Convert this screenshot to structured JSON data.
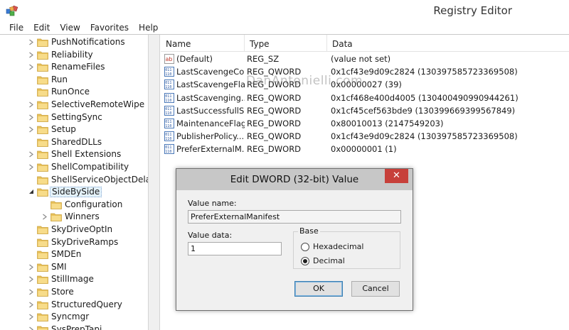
{
  "window": {
    "title": "Registry Editor"
  },
  "menu": [
    "File",
    "Edit",
    "View",
    "Favorites",
    "Help"
  ],
  "tree": {
    "items": [
      {
        "label": "PushNotifications",
        "level": 0,
        "expandable": true
      },
      {
        "label": "Reliability",
        "level": 0,
        "expandable": true
      },
      {
        "label": "RenameFiles",
        "level": 0,
        "expandable": true
      },
      {
        "label": "Run",
        "level": 0,
        "expandable": false
      },
      {
        "label": "RunOnce",
        "level": 0,
        "expandable": false
      },
      {
        "label": "SelectiveRemoteWipe",
        "level": 0,
        "expandable": true
      },
      {
        "label": "SettingSync",
        "level": 0,
        "expandable": true
      },
      {
        "label": "Setup",
        "level": 0,
        "expandable": true
      },
      {
        "label": "SharedDLLs",
        "level": 0,
        "expandable": false
      },
      {
        "label": "Shell Extensions",
        "level": 0,
        "expandable": true
      },
      {
        "label": "ShellCompatibility",
        "level": 0,
        "expandable": true
      },
      {
        "label": "ShellServiceObjectDelayLo",
        "level": 0,
        "expandable": false
      },
      {
        "label": "SideBySide",
        "level": 0,
        "expandable": true,
        "expanded": true,
        "selected": true
      },
      {
        "label": "Configuration",
        "level": 1,
        "expandable": false
      },
      {
        "label": "Winners",
        "level": 1,
        "expandable": true
      },
      {
        "label": "SkyDriveOptIn",
        "level": 0,
        "expandable": false
      },
      {
        "label": "SkyDriveRamps",
        "level": 0,
        "expandable": false
      },
      {
        "label": "SMDEn",
        "level": 0,
        "expandable": false
      },
      {
        "label": "SMI",
        "level": 0,
        "expandable": true
      },
      {
        "label": "StillImage",
        "level": 0,
        "expandable": true
      },
      {
        "label": "Store",
        "level": 0,
        "expandable": true
      },
      {
        "label": "StructuredQuery",
        "level": 0,
        "expandable": true
      },
      {
        "label": "Syncmgr",
        "level": 0,
        "expandable": true
      },
      {
        "label": "SysPrepTapi",
        "level": 0,
        "expandable": true
      }
    ]
  },
  "list": {
    "columns": {
      "name": "Name",
      "type": "Type",
      "data": "Data"
    },
    "rows": [
      {
        "icon": "string-value-icon",
        "name": "(Default)",
        "type": "REG_SZ",
        "data": "(value not set)"
      },
      {
        "icon": "binary-value-icon",
        "name": "LastScavengeCo...",
        "type": "REG_QWORD",
        "data": "0x1cf43e9d09c2824 (130397585723369508)"
      },
      {
        "icon": "binary-value-icon",
        "name": "LastScavengeFla...",
        "type": "REG_DWORD",
        "data": "0x00000027 (39)"
      },
      {
        "icon": "binary-value-icon",
        "name": "LastScavenging...",
        "type": "REG_QWORD",
        "data": "0x1cf468e400d4005 (130400490990944261)"
      },
      {
        "icon": "binary-value-icon",
        "name": "LastSuccessfullS...",
        "type": "REG_QWORD",
        "data": "0x1cf45cef563bde9 (130399669399567849)"
      },
      {
        "icon": "binary-value-icon",
        "name": "MaintenanceFlags",
        "type": "REG_DWORD",
        "data": "0x80010013 (2147549203)"
      },
      {
        "icon": "binary-value-icon",
        "name": "PublisherPolicy...",
        "type": "REG_QWORD",
        "data": "0x1cf43e9d09c2824 (130397585723369508)"
      },
      {
        "icon": "binary-value-icon",
        "name": "PreferExternalM...",
        "type": "REG_DWORD",
        "data": "0x00000001 (1)"
      }
    ]
  },
  "dialog": {
    "title": "Edit DWORD (32-bit) Value",
    "close_label": "✕",
    "value_name_label": "Value name:",
    "value_name": "PreferExternalManifest",
    "value_data_label": "Value data:",
    "value_data": "1",
    "base_label": "Base",
    "hex_label": "Hexadecimal",
    "dec_label": "Decimal",
    "selected_base": "Decimal",
    "ok_label": "OK",
    "cancel_label": "Cancel"
  },
  "watermark": "DanAntonielli.com",
  "colors": {
    "title_bar_dialog": "#c7c7c7",
    "close_button": "#c7403a",
    "folder": "#e8c15a",
    "selection": "#e5f3fb"
  }
}
